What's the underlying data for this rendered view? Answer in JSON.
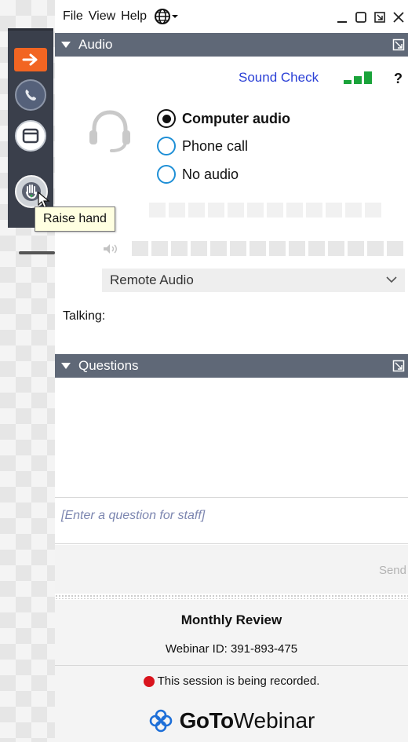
{
  "menu": {
    "file": "File",
    "view": "View",
    "help": "Help"
  },
  "icons": {
    "left_strip": [
      "arrow-right-icon",
      "phone-icon",
      "window-icon",
      "raise-hand-icon"
    ],
    "window_controls": [
      "minimize-icon",
      "restore-icon",
      "popout-icon",
      "close-icon"
    ]
  },
  "tooltip": {
    "text": "Raise hand"
  },
  "audio": {
    "header": "Audio",
    "sound_check": "Sound Check",
    "help": "?",
    "options": [
      {
        "label": "Computer audio",
        "selected": true
      },
      {
        "label": "Phone call",
        "selected": false
      },
      {
        "label": "No audio",
        "selected": false
      }
    ],
    "speaker_select": "Remote Audio",
    "talking_label": "Talking:"
  },
  "questions": {
    "header": "Questions",
    "input_placeholder": "[Enter a question for staff]",
    "send_label": "Send"
  },
  "footer": {
    "webinar_title": "Monthly Review",
    "webinar_id": "Webinar ID: 391-893-475",
    "recording_notice": "This session is being recorded.",
    "brand_bold": "GoTo",
    "brand_light": "Webinar"
  },
  "colors": {
    "header_bar": "#5f6877",
    "accent_orange": "#f26522",
    "link_blue": "#2a3fd6",
    "signal_green": "#1aa33a",
    "recording_red": "#d9141d",
    "brand_blue": "#1d6fd8"
  }
}
